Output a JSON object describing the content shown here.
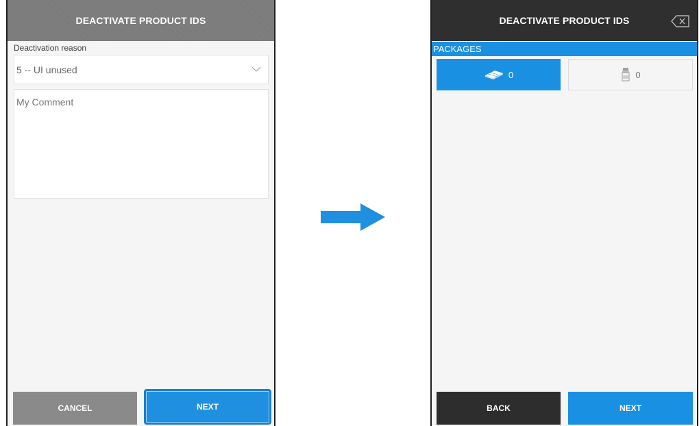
{
  "left_screen": {
    "title": "DEACTIVATE PRODUCT IDS",
    "reason_label": "Deactivation reason",
    "reason_value": "5 -- UI unused",
    "comment_placeholder": "My Comment",
    "cancel_label": "CANCEL",
    "next_label": "NEXT",
    "dropdown_icon": "chevron-down-icon"
  },
  "arrow_color": "#1f8fe0",
  "right_screen": {
    "title": "DEACTIVATE PRODUCT IDS",
    "close_icon": "backspace-icon",
    "section_title": "PACKAGES",
    "tiles": [
      {
        "icon": "pack-icon",
        "count": "0",
        "selected": true
      },
      {
        "icon": "bottle-icon",
        "count": "0",
        "selected": false
      }
    ],
    "back_label": "BACK",
    "next_label": "NEXT"
  },
  "colors": {
    "accent": "#1a90e3",
    "title_gray": "#7a7a7a",
    "title_dark": "#2f2f2f",
    "cancel_gray": "#8a8a8a",
    "back_dark": "#2d2d2d"
  }
}
